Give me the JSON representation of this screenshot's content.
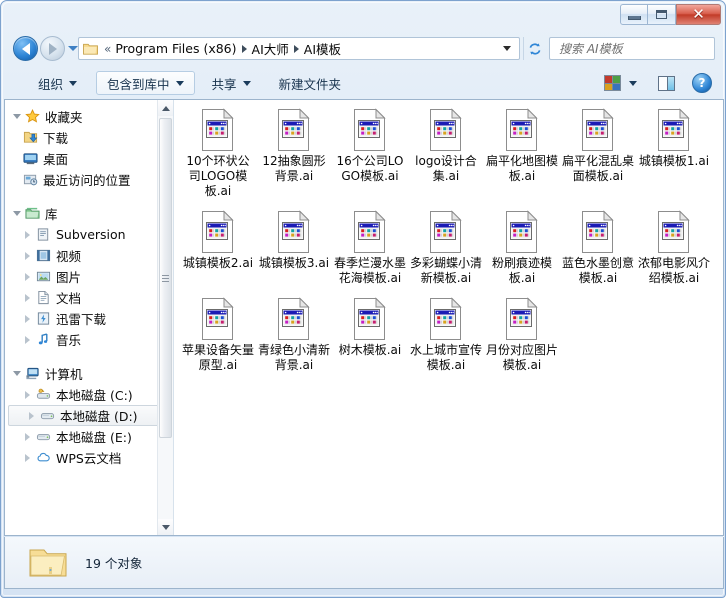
{
  "window": {
    "controls": {
      "minimize": "minimize-button",
      "maximize": "maximize-button",
      "close": "close-button",
      "close_glyph": "✕"
    }
  },
  "address_bar": {
    "back_tooltip": "返回",
    "forward_tooltip": "前进",
    "overflow_chevron": "«",
    "crumbs": [
      "Program Files (x86)",
      "AI大师",
      "AI模板"
    ],
    "refresh_icon": "refresh-icon"
  },
  "search": {
    "placeholder": "搜索 AI模板",
    "value": ""
  },
  "toolbar": {
    "items": [
      {
        "label": "组织",
        "has_caret": true,
        "framed": false
      },
      {
        "label": "包含到库中",
        "has_caret": true,
        "framed": true
      },
      {
        "label": "共享",
        "has_caret": true,
        "framed": false
      },
      {
        "label": "新建文件夹",
        "has_caret": false,
        "framed": false
      }
    ],
    "view_button": "view-options-icon",
    "view_caret": "chevron-down-icon",
    "preview_pane_button": "preview-pane-icon",
    "help_button": "?"
  },
  "sidebar": {
    "groups": [
      {
        "header": {
          "label": "收藏夹",
          "icon": "star-icon",
          "expanded": true
        },
        "items": [
          {
            "label": "下载",
            "icon": "downloads-folder-icon",
            "expander": false
          },
          {
            "label": "桌面",
            "icon": "desktop-icon",
            "expander": false
          },
          {
            "label": "最近访问的位置",
            "icon": "recent-places-icon",
            "expander": false
          }
        ]
      },
      {
        "header": {
          "label": "库",
          "icon": "library-icon",
          "expanded": true
        },
        "items": [
          {
            "label": "Subversion",
            "icon": "subversion-icon",
            "expander": true
          },
          {
            "label": "视频",
            "icon": "video-icon",
            "expander": true
          },
          {
            "label": "图片",
            "icon": "pictures-icon",
            "expander": true
          },
          {
            "label": "文档",
            "icon": "documents-icon",
            "expander": true
          },
          {
            "label": "迅雷下载",
            "icon": "thunder-download-icon",
            "expander": true
          },
          {
            "label": "音乐",
            "icon": "music-icon",
            "expander": true
          }
        ]
      },
      {
        "header": {
          "label": "计算机",
          "icon": "computer-icon",
          "expanded": true
        },
        "items": [
          {
            "label": "本地磁盘 (C:)",
            "icon": "system-drive-icon",
            "expander": true,
            "selected": false
          },
          {
            "label": "本地磁盘 (D:)",
            "icon": "drive-icon",
            "expander": true,
            "selected": true
          },
          {
            "label": "本地磁盘 (E:)",
            "icon": "drive-icon",
            "expander": true,
            "selected": false
          },
          {
            "label": "WPS云文档",
            "icon": "wps-cloud-icon",
            "expander": true,
            "selected": false
          }
        ]
      }
    ]
  },
  "files": [
    {
      "name": "10个环状公司LOGO模板.ai"
    },
    {
      "name": "12抽象圆形背景.ai"
    },
    {
      "name": "16个公司LOGO模板.ai"
    },
    {
      "name": "logo设计合集.ai"
    },
    {
      "name": "扁平化地图模板.ai"
    },
    {
      "name": "扁平化混乱桌面模板.ai"
    },
    {
      "name": "城镇模板1.ai"
    },
    {
      "name": "城镇模板2.ai"
    },
    {
      "name": "城镇模板3.ai"
    },
    {
      "name": "春季烂漫水墨花海模板.ai"
    },
    {
      "name": "多彩蝴蝶小清新模板.ai"
    },
    {
      "name": "粉刷痕迹模板.ai"
    },
    {
      "name": "蓝色水墨创意模板.ai"
    },
    {
      "name": "浓郁电影风介绍模板.ai"
    },
    {
      "name": "苹果设备矢量原型.ai"
    },
    {
      "name": "青绿色小清新背景.ai"
    },
    {
      "name": "树木模板.ai"
    },
    {
      "name": "水上城市宣传模板.ai"
    },
    {
      "name": "月份对应图片模板.ai"
    }
  ],
  "status_bar": {
    "text": "19 个对象",
    "icon": "folder-icon"
  },
  "colors": {
    "frame_border": "#7da2ce",
    "accent_blue": "#2f86d6",
    "close_red": "#c23b28",
    "folder_yellow": "#f5d07a",
    "text": "#0a0a0a"
  }
}
